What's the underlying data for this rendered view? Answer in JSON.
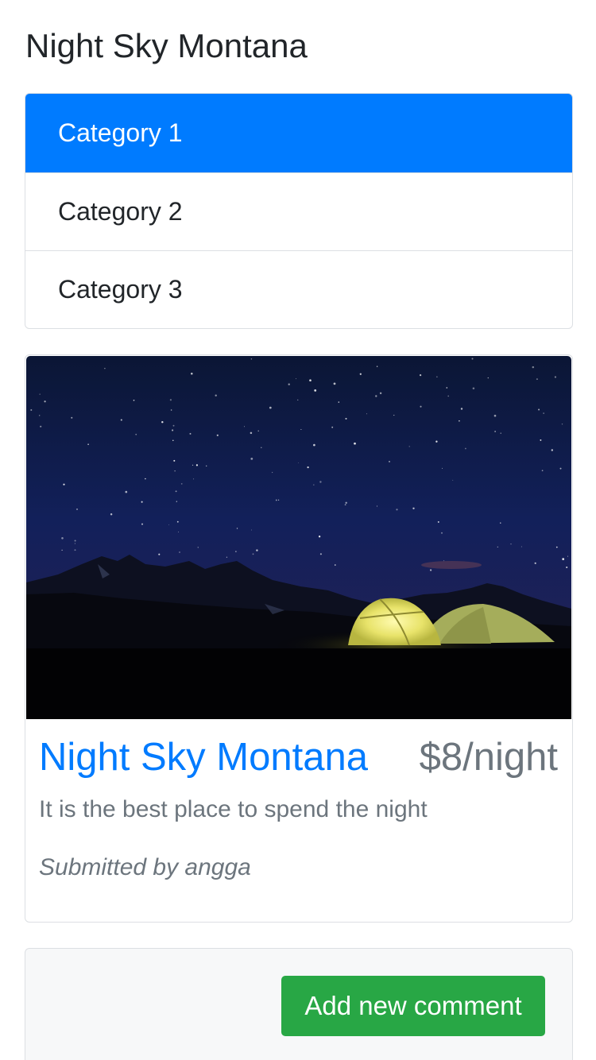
{
  "header": {
    "title": "Night Sky Montana"
  },
  "categories": [
    {
      "label": "Category 1",
      "active": true
    },
    {
      "label": "Category 2",
      "active": false
    },
    {
      "label": "Category 3",
      "active": false
    }
  ],
  "campground": {
    "image_description": "night-sky-tents-photo",
    "name": "Night Sky Montana",
    "price": "$8/night",
    "description": "It is the best place to spend the night",
    "submitted_by": "Submitted by angga"
  },
  "comments": {
    "add_button_label": "Add new comment"
  },
  "colors": {
    "primary": "#007bff",
    "success": "#28a745",
    "muted": "#6c757d",
    "text": "#212529"
  }
}
